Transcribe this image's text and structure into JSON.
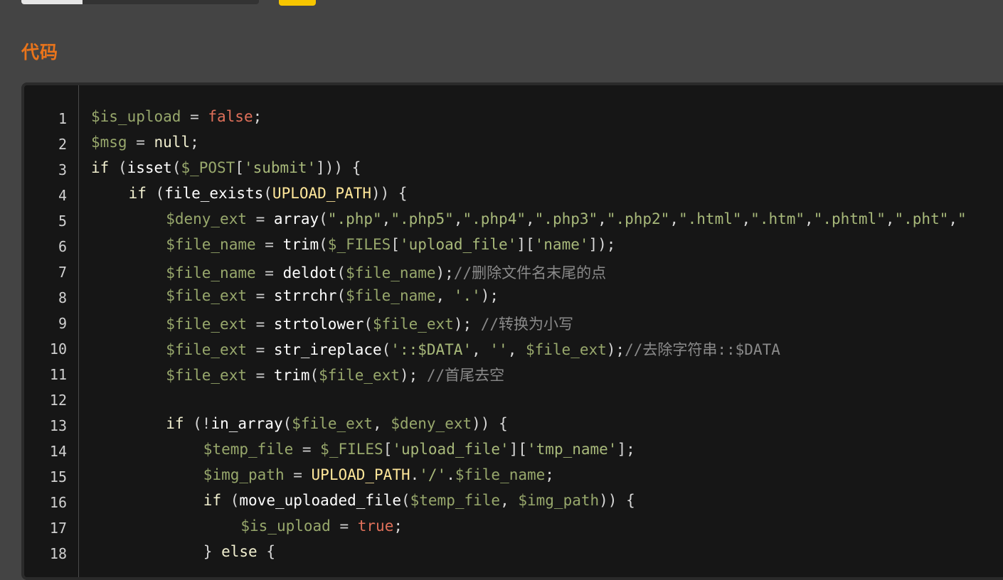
{
  "section": {
    "title": "代码"
  },
  "code": {
    "lines": [
      {
        "n": "1",
        "indent": 0,
        "tokens": [
          [
            "var",
            "$is_upload"
          ],
          [
            "op",
            " = "
          ],
          [
            "bool",
            "false"
          ],
          [
            "punc",
            ";"
          ]
        ]
      },
      {
        "n": "2",
        "indent": 0,
        "tokens": [
          [
            "var",
            "$msg"
          ],
          [
            "op",
            " = "
          ],
          [
            "kw",
            "null"
          ],
          [
            "punc",
            ";"
          ]
        ]
      },
      {
        "n": "3",
        "indent": 0,
        "tokens": [
          [
            "kw",
            "if"
          ],
          [
            "punc",
            " ("
          ],
          [
            "fn",
            "isset"
          ],
          [
            "punc",
            "("
          ],
          [
            "var",
            "$_POST"
          ],
          [
            "punc",
            "["
          ],
          [
            "str",
            "'submit'"
          ],
          [
            "punc",
            "])) {"
          ]
        ]
      },
      {
        "n": "4",
        "indent": 1,
        "tokens": [
          [
            "kw",
            "if"
          ],
          [
            "punc",
            " ("
          ],
          [
            "fn",
            "file_exists"
          ],
          [
            "punc",
            "("
          ],
          [
            "const",
            "UPLOAD_PATH"
          ],
          [
            "punc",
            ")) {"
          ]
        ]
      },
      {
        "n": "5",
        "indent": 2,
        "tokens": [
          [
            "var",
            "$deny_ext"
          ],
          [
            "op",
            " = "
          ],
          [
            "fn",
            "array"
          ],
          [
            "punc",
            "("
          ],
          [
            "str",
            "\".php\""
          ],
          [
            "punc",
            ","
          ],
          [
            "str",
            "\".php5\""
          ],
          [
            "punc",
            ","
          ],
          [
            "str",
            "\".php4\""
          ],
          [
            "punc",
            ","
          ],
          [
            "str",
            "\".php3\""
          ],
          [
            "punc",
            ","
          ],
          [
            "str",
            "\".php2\""
          ],
          [
            "punc",
            ","
          ],
          [
            "str",
            "\".html\""
          ],
          [
            "punc",
            ","
          ],
          [
            "str",
            "\".htm\""
          ],
          [
            "punc",
            ","
          ],
          [
            "str",
            "\".phtml\""
          ],
          [
            "punc",
            ","
          ],
          [
            "str",
            "\".pht\""
          ],
          [
            "punc",
            ","
          ],
          [
            "str",
            "\""
          ]
        ]
      },
      {
        "n": "6",
        "indent": 2,
        "tokens": [
          [
            "var",
            "$file_name"
          ],
          [
            "op",
            " = "
          ],
          [
            "fn",
            "trim"
          ],
          [
            "punc",
            "("
          ],
          [
            "var",
            "$_FILES"
          ],
          [
            "punc",
            "["
          ],
          [
            "str",
            "'upload_file'"
          ],
          [
            "punc",
            "]["
          ],
          [
            "str",
            "'name'"
          ],
          [
            "punc",
            "]);"
          ]
        ]
      },
      {
        "n": "7",
        "indent": 2,
        "tokens": [
          [
            "var",
            "$file_name"
          ],
          [
            "op",
            " = "
          ],
          [
            "fn",
            "deldot"
          ],
          [
            "punc",
            "("
          ],
          [
            "var",
            "$file_name"
          ],
          [
            "punc",
            ");"
          ],
          [
            "cm",
            "//删除文件名末尾的点"
          ]
        ]
      },
      {
        "n": "8",
        "indent": 2,
        "tokens": [
          [
            "var",
            "$file_ext"
          ],
          [
            "op",
            " = "
          ],
          [
            "fn",
            "strrchr"
          ],
          [
            "punc",
            "("
          ],
          [
            "var",
            "$file_name"
          ],
          [
            "punc",
            ", "
          ],
          [
            "str",
            "'.'"
          ],
          [
            "punc",
            ");"
          ]
        ]
      },
      {
        "n": "9",
        "indent": 2,
        "tokens": [
          [
            "var",
            "$file_ext"
          ],
          [
            "op",
            " = "
          ],
          [
            "fn",
            "strtolower"
          ],
          [
            "punc",
            "("
          ],
          [
            "var",
            "$file_ext"
          ],
          [
            "punc",
            "); "
          ],
          [
            "cm",
            "//转换为小写"
          ]
        ]
      },
      {
        "n": "10",
        "indent": 2,
        "tokens": [
          [
            "var",
            "$file_ext"
          ],
          [
            "op",
            " = "
          ],
          [
            "fn",
            "str_ireplace"
          ],
          [
            "punc",
            "("
          ],
          [
            "str",
            "'::$DATA'"
          ],
          [
            "punc",
            ", "
          ],
          [
            "str",
            "''"
          ],
          [
            "punc",
            ", "
          ],
          [
            "var",
            "$file_ext"
          ],
          [
            "punc",
            ");"
          ],
          [
            "cm",
            "//去除字符串::$DATA"
          ]
        ]
      },
      {
        "n": "11",
        "indent": 2,
        "tokens": [
          [
            "var",
            "$file_ext"
          ],
          [
            "op",
            " = "
          ],
          [
            "fn",
            "trim"
          ],
          [
            "punc",
            "("
          ],
          [
            "var",
            "$file_ext"
          ],
          [
            "punc",
            "); "
          ],
          [
            "cm",
            "//首尾去空"
          ]
        ]
      },
      {
        "n": "12",
        "indent": 0,
        "tokens": []
      },
      {
        "n": "13",
        "indent": 2,
        "tokens": [
          [
            "kw",
            "if"
          ],
          [
            "punc",
            " ("
          ],
          [
            "op",
            "!"
          ],
          [
            "fn",
            "in_array"
          ],
          [
            "punc",
            "("
          ],
          [
            "var",
            "$file_ext"
          ],
          [
            "punc",
            ", "
          ],
          [
            "var",
            "$deny_ext"
          ],
          [
            "punc",
            ")) {"
          ]
        ]
      },
      {
        "n": "14",
        "indent": 3,
        "tokens": [
          [
            "var",
            "$temp_file"
          ],
          [
            "op",
            " = "
          ],
          [
            "var",
            "$_FILES"
          ],
          [
            "punc",
            "["
          ],
          [
            "str",
            "'upload_file'"
          ],
          [
            "punc",
            "]["
          ],
          [
            "str",
            "'tmp_name'"
          ],
          [
            "punc",
            "];"
          ]
        ]
      },
      {
        "n": "15",
        "indent": 3,
        "tokens": [
          [
            "var",
            "$img_path"
          ],
          [
            "op",
            " = "
          ],
          [
            "const",
            "UPLOAD_PATH"
          ],
          [
            "punc",
            "."
          ],
          [
            "str",
            "'/'"
          ],
          [
            "punc",
            "."
          ],
          [
            "var",
            "$file_name"
          ],
          [
            "punc",
            ";"
          ]
        ]
      },
      {
        "n": "16",
        "indent": 3,
        "tokens": [
          [
            "kw",
            "if"
          ],
          [
            "punc",
            " ("
          ],
          [
            "fn",
            "move_uploaded_file"
          ],
          [
            "punc",
            "("
          ],
          [
            "var",
            "$temp_file"
          ],
          [
            "punc",
            ", "
          ],
          [
            "var",
            "$img_path"
          ],
          [
            "punc",
            ")) {"
          ]
        ]
      },
      {
        "n": "17",
        "indent": 4,
        "tokens": [
          [
            "var",
            "$is_upload"
          ],
          [
            "op",
            " = "
          ],
          [
            "bool",
            "true"
          ],
          [
            "punc",
            ";"
          ]
        ]
      },
      {
        "n": "18",
        "indent": 3,
        "tokens": [
          [
            "punc",
            "} "
          ],
          [
            "kw",
            "else"
          ],
          [
            "punc",
            " {"
          ]
        ]
      }
    ]
  }
}
